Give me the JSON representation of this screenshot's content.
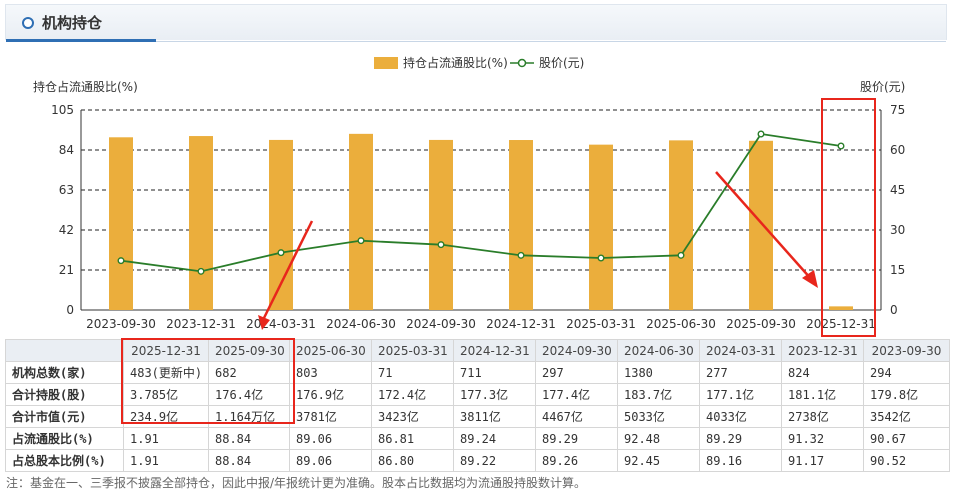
{
  "header": {
    "title": "机构持仓"
  },
  "legend": {
    "bar_label": "持仓占流通股比(%)",
    "line_label": "股价(元)"
  },
  "chart_data": {
    "type": "bar",
    "categories": [
      "2023-09-30",
      "2023-12-31",
      "2024-03-31",
      "2024-06-30",
      "2024-09-30",
      "2024-12-31",
      "2025-03-31",
      "2025-06-30",
      "2025-09-30",
      "2025-12-31"
    ],
    "series": [
      {
        "name": "持仓占流通股比(%)",
        "type": "bar",
        "axis": "left",
        "values": [
          90.67,
          91.32,
          89.29,
          92.48,
          89.29,
          89.24,
          86.81,
          89.06,
          88.84,
          1.91
        ]
      },
      {
        "name": "股价(元)",
        "type": "line",
        "axis": "right",
        "values": [
          18.5,
          14.5,
          21.5,
          26.0,
          24.5,
          20.5,
          19.5,
          20.5,
          66.0,
          61.5
        ]
      }
    ],
    "ylabel": "持仓占流通股比(%)",
    "y2label": "股价(元)",
    "ylim": [
      0,
      105
    ],
    "yticks": [
      0,
      21,
      42,
      63,
      84,
      105
    ],
    "y2lim": [
      0,
      75
    ],
    "y2ticks": [
      0,
      15,
      30,
      45,
      60,
      75
    ],
    "grid": true,
    "legend_position": "top-center",
    "colors": {
      "bar": "#EBAE3C",
      "line": "#2A7D2A"
    }
  },
  "table": {
    "headers": [
      "",
      "2025-12-31",
      "2025-09-30",
      "2025-06-30",
      "2025-03-31",
      "2024-12-31",
      "2024-09-30",
      "2024-06-30",
      "2024-03-31",
      "2023-12-31",
      "2023-09-30"
    ],
    "rows": [
      {
        "label": "机构总数(家)",
        "cells": [
          "483(更新中)",
          "682",
          "803",
          "71",
          "711",
          "297",
          "1380",
          "277",
          "824",
          "294"
        ]
      },
      {
        "label": "合计持股(股)",
        "cells": [
          "3.785亿",
          "176.4亿",
          "176.9亿",
          "172.4亿",
          "177.3亿",
          "177.4亿",
          "183.7亿",
          "177.1亿",
          "181.1亿",
          "179.8亿"
        ]
      },
      {
        "label": "合计市值(元)",
        "cells": [
          "234.9亿",
          "1.164万亿",
          "3781亿",
          "3423亿",
          "3811亿",
          "4467亿",
          "5033亿",
          "4033亿",
          "2738亿",
          "3542亿"
        ]
      },
      {
        "label": "占流通股比(%)",
        "cells": [
          "1.91",
          "88.84",
          "89.06",
          "86.81",
          "89.24",
          "89.29",
          "92.48",
          "89.29",
          "91.32",
          "90.67"
        ]
      },
      {
        "label": "占总股本比例(%)",
        "cells": [
          "1.91",
          "88.84",
          "89.06",
          "86.80",
          "89.22",
          "89.26",
          "92.45",
          "89.16",
          "91.17",
          "90.52"
        ]
      }
    ]
  },
  "note": "注：基金在一、三季报不披露全部持仓，因此中报/年报统计更为准确。股本占比数据均为流通股持股数计算。"
}
